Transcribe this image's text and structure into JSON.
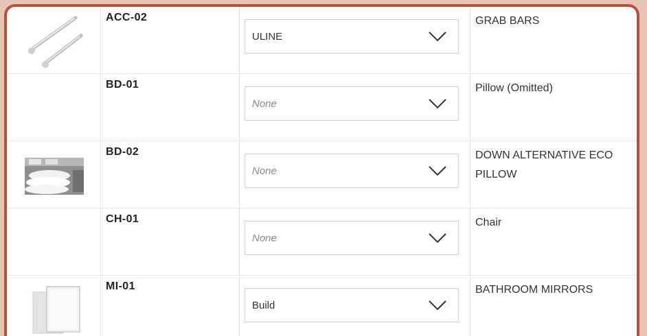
{
  "rows": [
    {
      "code": "ACC-02",
      "vendor": "ULINE",
      "vendor_is_placeholder": false,
      "description": "GRAB BARS",
      "thumbnail": "grab-bars"
    },
    {
      "code": "BD-01",
      "vendor": "None",
      "vendor_is_placeholder": true,
      "description": "Pillow (Omitted)",
      "thumbnail": ""
    },
    {
      "code": "BD-02",
      "vendor": "None",
      "vendor_is_placeholder": true,
      "description": "DOWN ALTERNATIVE ECO PILLOW",
      "thumbnail": "pillows"
    },
    {
      "code": "CH-01",
      "vendor": "None",
      "vendor_is_placeholder": true,
      "description": "Chair",
      "thumbnail": ""
    },
    {
      "code": "MI-01",
      "vendor": "Build",
      "vendor_is_placeholder": false,
      "description": "BATHROOM MIRRORS",
      "thumbnail": "mirrors"
    }
  ],
  "icons": {
    "dropdown": "chevron-down-icon"
  },
  "colors": {
    "frame_border": "#b5513f",
    "background": "#e8c4b4"
  }
}
